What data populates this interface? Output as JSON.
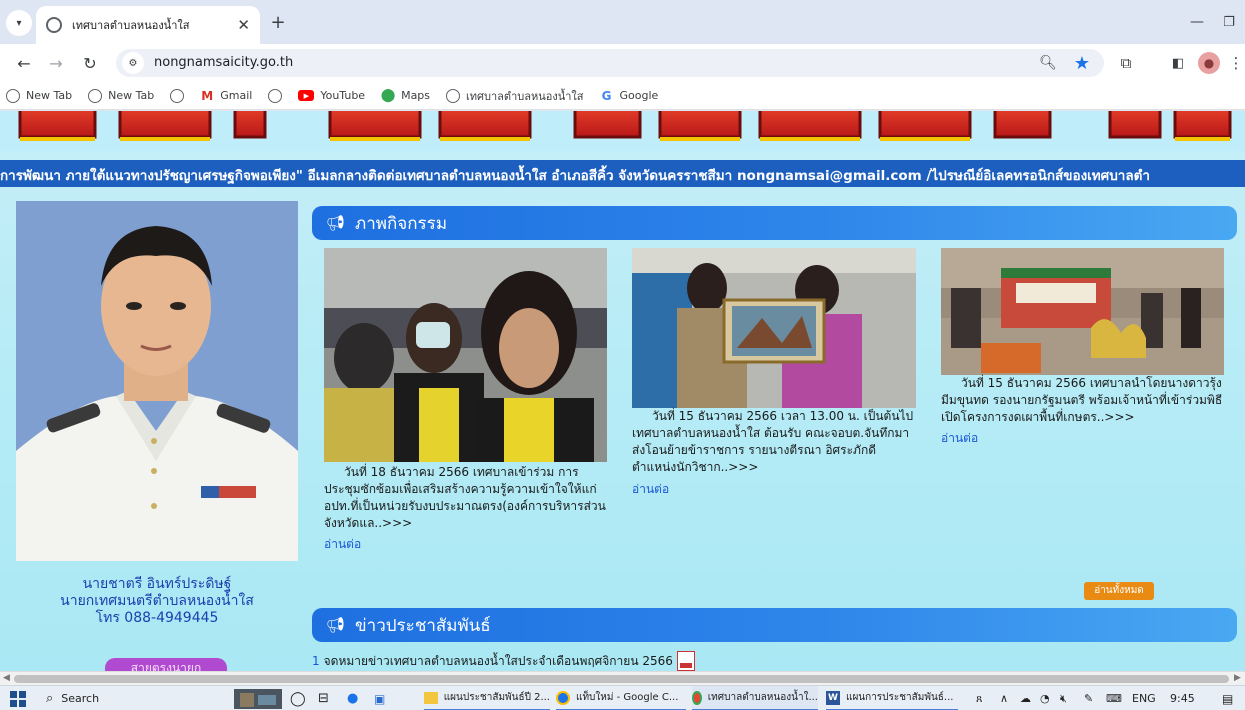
{
  "browser": {
    "tab_title": "เทศบาลตำบลหนองน้ำใส",
    "url": "nongnamsaicity.go.th",
    "bookmarks": [
      {
        "label": "New Tab",
        "icon": "globe-icon"
      },
      {
        "label": "New Tab",
        "icon": "globe-icon"
      },
      {
        "label": "",
        "icon": "globe-icon"
      },
      {
        "label": "Gmail",
        "icon": "gmail-icon"
      },
      {
        "label": "",
        "icon": "globe-icon"
      },
      {
        "label": "YouTube",
        "icon": "youtube-icon"
      },
      {
        "label": "Maps",
        "icon": "maps-icon"
      },
      {
        "label": "เทศบาลตำบลหนองน้ำใส",
        "icon": "globe-icon"
      },
      {
        "label": "Google",
        "icon": "google-icon"
      }
    ]
  },
  "page": {
    "marquee": "การพัฒนา ภายใต้แนวทางปรัชญาเศรษฐกิจพอเพียง\" อีเมลกลางติดต่อเทศบาลตำบลหนองน้ำใส อำเภอสีคิ้ว จังหวัดนครราชสีมา  nongnamsai@gmail.com  /ไปรษณีย์อิเลคทรอนิกส์ของเทศบาลตำ",
    "mayor": {
      "name": "นายชาตรี  อินทร์ประดิษฐ์",
      "position": "นายกเทศมนตรีตำบลหนองน้ำใส",
      "phone": "โทร 088-4949445"
    },
    "side_badge": "สายตรงนายก",
    "activities": {
      "heading": "ภาพกิจกรรม",
      "items": [
        {
          "text": "วันที่ 18 ธันวาคม 2566 เทศบาลเข้าร่วม การประชุมซักซ้อมเพื่อเสริมสร้างความรู้ความเข้าใจให้แก่ อปท.ที่เป็นหน่วยรับงบประมาณตรง(องค์การบริหารส่วนจังหวัดแล..>>>",
          "more": "อ่านต่อ"
        },
        {
          "text": "วันที่ 15 ธันวาคม 2566 เวลา 13.00 น. เป็นต้นไป เทศบาลตำบลหนองน้ำใส ต้อนรับ คณะจอบต.จันทึกมา ส่งโอนย้ายข้าราชการ รายนางตีรณา อิศระภักดี ตำแหน่งนักวิชาก..>>>",
          "more": "อ่านต่อ"
        },
        {
          "text": "วันที่ 15 ธันวาคม 2566 เทศบาลนำโดยนางดาวรุ้ง มีมขุนทด รองนายกรัฐมนตรี พร้อมเจ้าหน้าที่เข้าร่วมพิธีเปิดโครงการงดเผาพื้นที่เกษตร..>>>",
          "more": "อ่านต่อ"
        }
      ],
      "more_all": "อ่านทั้งหมด"
    },
    "news": {
      "heading": "ข่าวประชาสัมพันธ์",
      "items": [
        {
          "num": "1",
          "text": "จดหมายข่าวเทศบาลตำบลหนองน้ำใสประจำเดือนพฤศจิกายน 2566"
        }
      ]
    }
  },
  "taskbar": {
    "search_label": "Search",
    "apps": [
      {
        "label": "แผนประชาสัมพันธ์ปี 2...",
        "icon": "folder-icon"
      },
      {
        "label": "แท็บใหม่ - Google C...",
        "icon": "chrome-icon"
      },
      {
        "label": "เทศบาลตำบลหนองน้ำใ...",
        "icon": "chrome-icon"
      },
      {
        "label": "แผนการประชาสัมพันธ์...",
        "icon": "word-icon"
      }
    ],
    "language": "ENG",
    "time": "9:45"
  },
  "colors": {
    "section_blue": "#1e6fe0",
    "marquee_blue": "#1d5fbf",
    "link_blue": "#1a56d6",
    "orange_button": "#e98a13",
    "page_bg": "#b8ecf6"
  }
}
